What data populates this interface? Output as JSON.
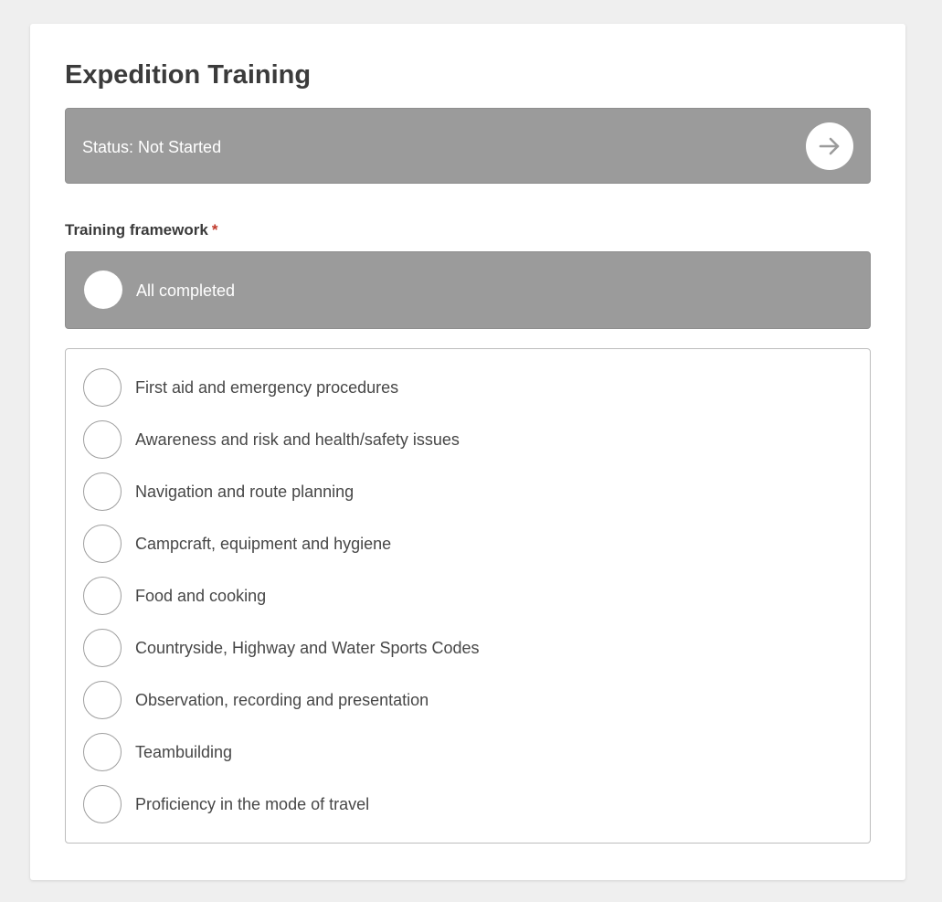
{
  "page": {
    "title": "Expedition Training"
  },
  "status": {
    "text": "Status: Not Started",
    "action_icon": "arrow-right-icon"
  },
  "framework": {
    "label": "Training framework",
    "required_marker": "*",
    "all_completed_label": "All completed",
    "items": [
      {
        "label": "First aid and emergency procedures",
        "checked": false
      },
      {
        "label": "Awareness and risk and health/safety issues",
        "checked": false
      },
      {
        "label": "Navigation and route planning",
        "checked": false
      },
      {
        "label": "Campcraft, equipment and hygiene",
        "checked": false
      },
      {
        "label": "Food and cooking",
        "checked": false
      },
      {
        "label": "Countryside, Highway and Water Sports Codes",
        "checked": false
      },
      {
        "label": "Observation, recording and presentation",
        "checked": false
      },
      {
        "label": "Teambuilding",
        "checked": false
      },
      {
        "label": "Proficiency in the mode of travel",
        "checked": false
      }
    ]
  },
  "colors": {
    "background": "#efefef",
    "panel": "#ffffff",
    "status_bar": "#9b9b9b",
    "required": "#c0392b",
    "text": "#3b3b3b"
  }
}
